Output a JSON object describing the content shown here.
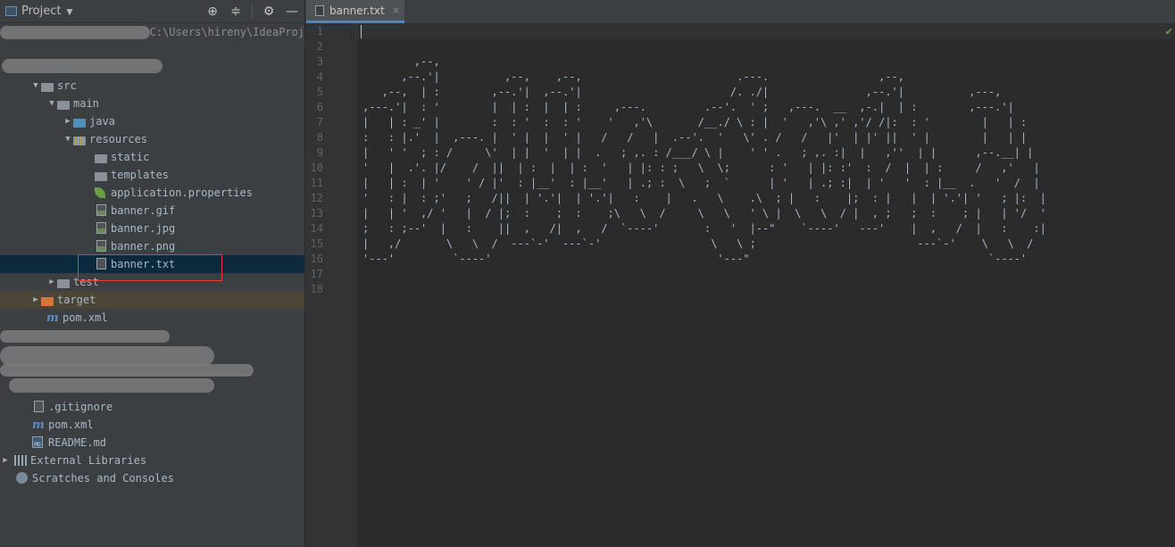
{
  "panel": {
    "title": "Project",
    "path_fragment": "C:\\Users\\hireny\\IdeaProj"
  },
  "tree": [
    {
      "label": "src"
    },
    {
      "label": "main"
    },
    {
      "label": "java"
    },
    {
      "label": "resources"
    },
    {
      "label": "static"
    },
    {
      "label": "templates"
    },
    {
      "label": "application.properties"
    },
    {
      "label": "banner.gif"
    },
    {
      "label": "banner.jpg"
    },
    {
      "label": "banner.png"
    },
    {
      "label": "banner.txt"
    },
    {
      "label": "test"
    },
    {
      "label": "target"
    },
    {
      "label": "pom.xml"
    },
    {
      "label": ".gitignore"
    },
    {
      "label": "pom.xml"
    },
    {
      "label": "README.md"
    },
    {
      "label": "External Libraries"
    },
    {
      "label": "Scratches and Consoles"
    }
  ],
  "editor": {
    "tab_label": "banner.txt",
    "tab_close": "×",
    "line_numbers": [
      "1",
      "2",
      "3",
      "4",
      "5",
      "6",
      "7",
      "8",
      "9",
      "10",
      "11",
      "12",
      "13",
      "14",
      "15",
      "16",
      "17",
      "18"
    ],
    "content": "\n\n        ,--,\n      ,--.'|          ,--,    ,--,                        .---.                 ,--,\n   ,--,  | :        ,--.'|  ,--.'|                       /. ./|               ,--.'|          ,---,\n,---.'|  : '        |  | :  |  | :     ,---.         .--'.  ' ;   ,---.  __  ,-.|  | :        ,---.'|\n|   | : _' |        :  : '  :  : '    '   ,'\\       /__./ \\ : |  '   ,'\\ ,' ,'/ /|:  : '        |   | :\n:   : |.'  |  ,---. |  ' |  |  ' |   /   /   |  .--'.  '   \\' . /   /   |'  | |' ||  ' |        |   | |\n|   ' '  ; : /     \\'  | |  '  | |  .   ; ,. : /___/ \\ |    ' ' .   ; ,. :|  |   ,''  | |      ,--.__| |\n'   |  .'. |/    /  ||  | :  |  | :  '   | |: : ;   \\  \\;      : '   | |: :'  :  /  |  | :     /   ,'   |\n|   | :  | '    ' / |'  : |__'  : |__'   | .; :  \\   ;  `      | '   | .; :|  | '   '  : |__  .   '  /  |\n'   : |  : ;'   ;   /||  | '.'|  | '.'|   :    |   .   \\    .\\  ; |   :    |;  : |   |  | '.'| '   ; |:  |\n|   | '  ,/ '   |  / |;  :    ;  :    ;\\   \\  /     \\   \\   ' \\ |  \\   \\  / |  , ;   ;  :    ; |   | '/  '\n;   : ;--'  |   :    ||  ,   /|  ,   /  `----'       :   '  |--\"    `----'   ---'    |  ,   /  |   :    :|\n|   ,/       \\   \\  /  ---`-'  ---`-'                 \\   \\ ;                         ---`-'    \\   \\  /\n'---'         `----'                                   '---\"                                     `----'\n\n"
  },
  "colors": {
    "panel_bg": "#3c3f41",
    "editor_bg": "#2b2b2b",
    "selection": "#0d293e",
    "highlight_box": "#e0393e",
    "accent": "#4a88c7"
  }
}
